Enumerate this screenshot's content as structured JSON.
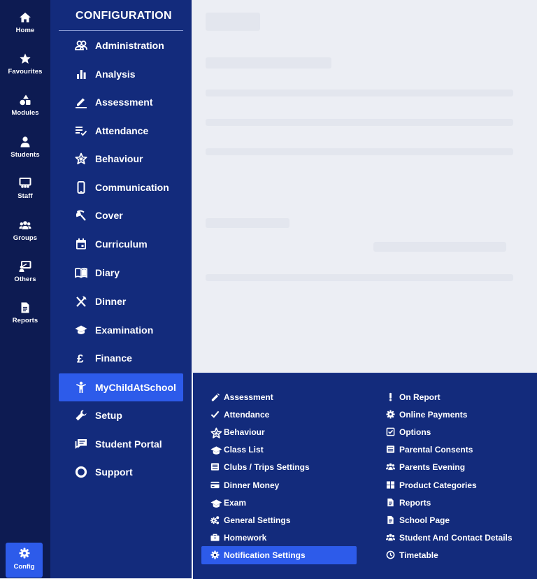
{
  "rail": {
    "items": [
      {
        "label": "Home",
        "icon": "home-icon"
      },
      {
        "label": "Favourites",
        "icon": "star-icon"
      },
      {
        "label": "Modules",
        "icon": "shapes-icon"
      },
      {
        "label": "Students",
        "icon": "person-icon"
      },
      {
        "label": "Staff",
        "icon": "presentation-board-icon"
      },
      {
        "label": "Groups",
        "icon": "group-icon"
      },
      {
        "label": "Others",
        "icon": "teacher-board-icon"
      },
      {
        "label": "Reports",
        "icon": "report-document-icon"
      }
    ],
    "config_label": "Config"
  },
  "panel": {
    "title": "CONFIGURATION",
    "items": [
      {
        "label": "Administration",
        "icon": "people-outline-icon"
      },
      {
        "label": "Analysis",
        "icon": "bar-chart-icon"
      },
      {
        "label": "Assessment",
        "icon": "pencil-underline-icon"
      },
      {
        "label": "Attendance",
        "icon": "checklist-icon"
      },
      {
        "label": "Behaviour",
        "icon": "star-outline-icon"
      },
      {
        "label": "Communication",
        "icon": "mobile-phone-icon"
      },
      {
        "label": "Cover",
        "icon": "umbrella-icon"
      },
      {
        "label": "Curriculum",
        "icon": "calendar-icon"
      },
      {
        "label": "Diary",
        "icon": "open-book-icon"
      },
      {
        "label": "Dinner",
        "icon": "cutlery-icon"
      },
      {
        "label": "Examination",
        "icon": "graduation-cap-icon"
      },
      {
        "label": "Finance",
        "icon": "pound-icon"
      },
      {
        "label": "MyChildAtSchool",
        "icon": "child-icon"
      },
      {
        "label": "Setup",
        "icon": "wrench-icon"
      },
      {
        "label": "Student Portal",
        "icon": "chat-icon"
      },
      {
        "label": "Support",
        "icon": "lifebuoy-icon"
      }
    ],
    "active_index": 12
  },
  "flyout": {
    "left_items": [
      {
        "label": "Assessment",
        "icon": "pencil-icon"
      },
      {
        "label": "Attendance",
        "icon": "check-icon"
      },
      {
        "label": "Behaviour",
        "icon": "star-outline-icon"
      },
      {
        "label": "Class List",
        "icon": "graduation-cap-icon"
      },
      {
        "label": "Clubs / Trips Settings",
        "icon": "list-icon"
      },
      {
        "label": "Dinner Money",
        "icon": "credit-card-icon"
      },
      {
        "label": "Exam",
        "icon": "graduation-cap-icon"
      },
      {
        "label": "General Settings",
        "icon": "cogs-icon"
      },
      {
        "label": "Homework",
        "icon": "briefcase-icon"
      },
      {
        "label": "Notification Settings",
        "icon": "gear-icon"
      }
    ],
    "right_items": [
      {
        "label": "On Report",
        "icon": "exclamation-icon"
      },
      {
        "label": "Online Payments",
        "icon": "gear-icon"
      },
      {
        "label": "Options",
        "icon": "checkbox-icon"
      },
      {
        "label": "Parental Consents",
        "icon": "list-icon"
      },
      {
        "label": "Parents Evening",
        "icon": "group-icon"
      },
      {
        "label": "Product Categories",
        "icon": "grid-icon"
      },
      {
        "label": "Reports",
        "icon": "document-icon"
      },
      {
        "label": "School Page",
        "icon": "document-icon"
      },
      {
        "label": "Student And Contact Details",
        "icon": "group-icon"
      },
      {
        "label": "Timetable",
        "icon": "clock-icon"
      }
    ],
    "active_left_index": 9
  }
}
